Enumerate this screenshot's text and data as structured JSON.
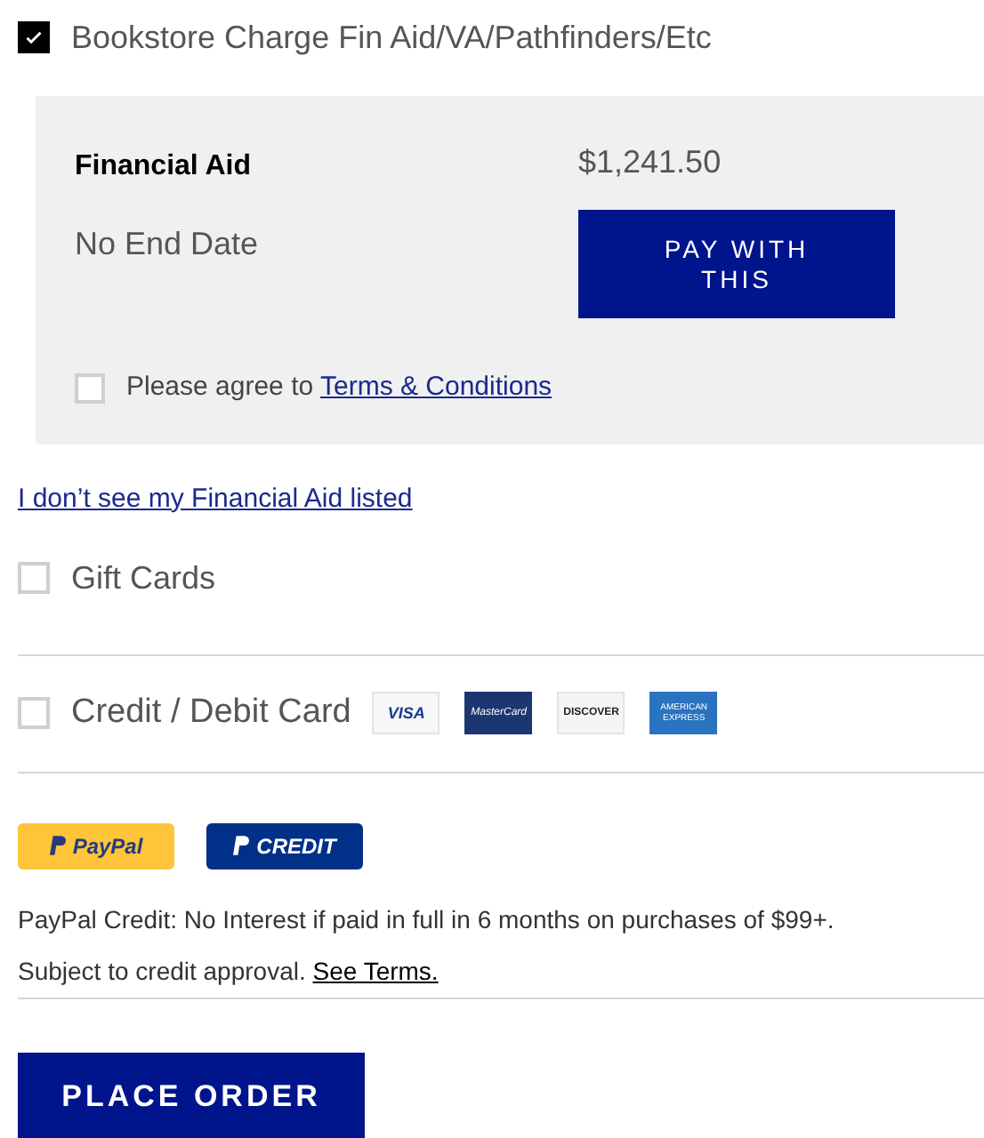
{
  "methods": [
    {
      "kind": "option",
      "label": "Bookstore Charge Fin Aid/VA/Pathfinders/Etc",
      "checked": true
    },
    {
      "kind": "panel",
      "aid_name": "Financial Aid",
      "amount": "$1,241.50",
      "end_date": "No End Date",
      "pay_button": "PAY WITH THIS",
      "agree": {
        "checked": false,
        "text": "Please agree to ",
        "link": "Terms & Conditions"
      }
    },
    {
      "kind": "link",
      "label": "I don’t see my Financial Aid listed"
    },
    {
      "kind": "option",
      "label": "Gift Cards",
      "checked": false
    },
    {
      "kind": "cards",
      "label": "Credit / Debit Card",
      "checked": false,
      "logos": [
        {
          "kind": "visa",
          "text": "VISA"
        },
        {
          "kind": "mastercard",
          "text": "MasterCard"
        },
        {
          "kind": "discover",
          "text": "DISCOVER"
        },
        {
          "kind": "amex",
          "text": "AMERICAN EXPRESS"
        }
      ]
    },
    {
      "kind": "paypal",
      "buttons": [
        {
          "kind": "paypal",
          "text": "PayPal"
        },
        {
          "kind": "credit",
          "text": "CREDIT"
        }
      ],
      "note": "PayPal Credit: No Interest if paid in full in 6 months on purchases of $99+.",
      "note2": "Subject to credit approval. ",
      "note_link": "See Terms."
    }
  ],
  "place_order": "PLACE ORDER"
}
